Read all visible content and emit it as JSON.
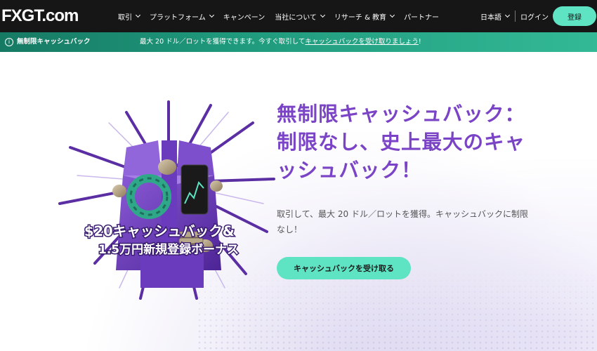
{
  "header": {
    "logo_text": "FXGT.com",
    "nav": [
      {
        "label": "取引",
        "dropdown": true
      },
      {
        "label": "プラットフォーム",
        "dropdown": true
      },
      {
        "label": "キャンペーン",
        "dropdown": false
      },
      {
        "label": "当社について",
        "dropdown": true
      },
      {
        "label": "リサーチ & 教育",
        "dropdown": true
      },
      {
        "label": "パートナー",
        "dropdown": false
      }
    ],
    "language": "日本語",
    "login": "ログイン",
    "register": "登録"
  },
  "banner": {
    "icon": "info-icon",
    "title": "無制限キャッシュバック",
    "text_prefix": "最大 20 ドル／ロットを獲得できます。今すぐ取引して",
    "link_text": "キャッシュバックを受け取りましょう",
    "text_suffix": "!"
  },
  "hero": {
    "headline": "無制限キャッシュバック：制限なし、史上最大のキャッシュバック！",
    "subtext": "取引して、最大 20 ドル／ロットを獲得。キャッシュバックに制限なし！",
    "cta": "キャッシュバックを受け取る",
    "artwork_line1": "$20キャッシュバック&",
    "artwork_line2": "1.5万円新規登録ボーナス"
  },
  "colors": {
    "nav_bg": "#161616",
    "accent": "#5ee4c3",
    "banner_green": "#1f9a7c",
    "headline_purple": "#7b44c6"
  }
}
